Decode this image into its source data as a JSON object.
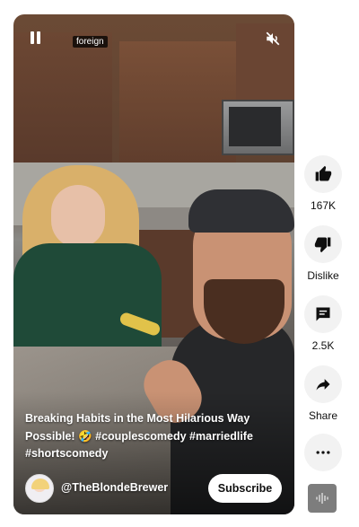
{
  "player": {
    "foreign_label": "foreign",
    "pause_icon": "pause-icon",
    "mute_icon": "volume-muted-icon"
  },
  "caption": {
    "title": "Breaking Habits in the Most Hilarious Way Possible!",
    "emoji": "🤣",
    "hashtags": [
      "#couplescomedy",
      "#marriedlife",
      "#shortscomedy"
    ]
  },
  "channel": {
    "name": "@TheBlondeBrewer",
    "subscribe_label": "Subscribe"
  },
  "actions": {
    "like": {
      "icon": "thumbs-up-icon",
      "label": "167K"
    },
    "dislike": {
      "icon": "thumbs-down-icon",
      "label": "Dislike"
    },
    "comments": {
      "icon": "comment-icon",
      "label": "2.5K"
    },
    "share": {
      "icon": "share-arrow-icon",
      "label": "Share"
    },
    "more": {
      "icon": "more-horizontal-icon"
    },
    "sound": {
      "icon": "audio-waveform-icon"
    }
  },
  "colors": {
    "subscribe_bg": "#ffffff",
    "action_circle_bg": "#f2f2f2",
    "text_primary": "#0f0f0f"
  }
}
